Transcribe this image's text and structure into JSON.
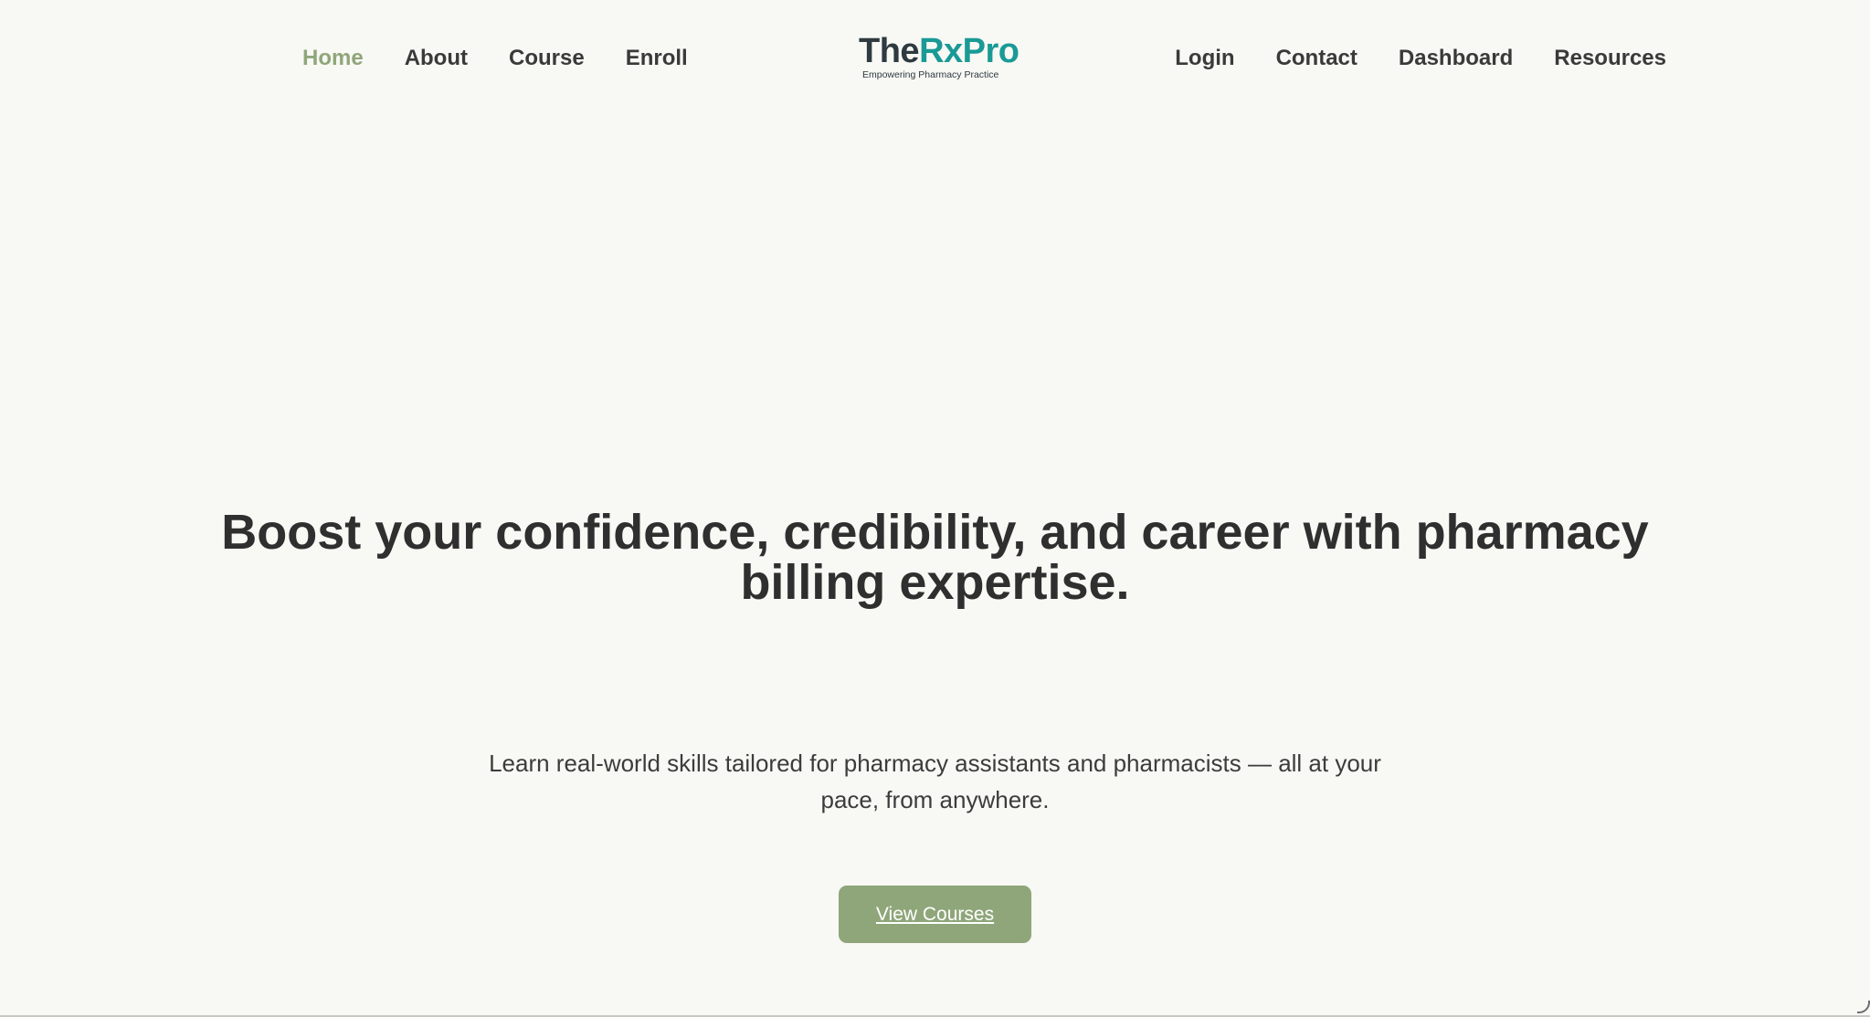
{
  "nav": {
    "left": [
      {
        "label": "Home",
        "active": true
      },
      {
        "label": "About",
        "active": false
      },
      {
        "label": "Course",
        "active": false
      },
      {
        "label": "Enroll",
        "active": false
      }
    ],
    "right": [
      {
        "label": "Login"
      },
      {
        "label": "Contact"
      },
      {
        "label": "Dashboard"
      },
      {
        "label": "Resources"
      }
    ]
  },
  "logo": {
    "part1": "The",
    "part2": "RxPro",
    "tagline": "Empowering Pharmacy Practice"
  },
  "hero": {
    "title": "Boost your confidence, credibility, and career with pharmacy billing expertise.",
    "subtitle": "Learn real-world skills tailored for pharmacy assistants and pharmacists — all at your pace, from anywhere.",
    "cta_label": "View Courses"
  },
  "colors": {
    "background": "#f8f8f4",
    "accent": "#8fa67a",
    "brand_teal": "#1a9a96",
    "brand_dark": "#2e3a40",
    "text": "#333333"
  }
}
